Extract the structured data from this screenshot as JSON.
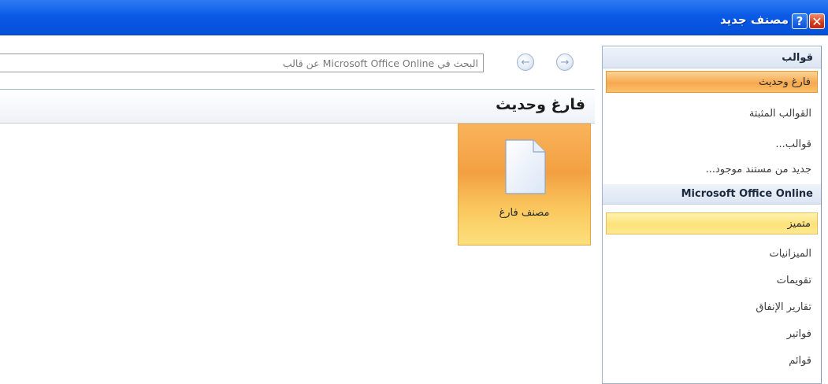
{
  "window": {
    "title": "مصنف جديد",
    "help_glyph": "?",
    "close_glyph": "✕"
  },
  "search": {
    "placeholder": "البحث في Microsoft Office Online عن قالب",
    "back_glyph": "←",
    "forward_glyph": "→"
  },
  "main": {
    "title": "فارغ وحديث",
    "tiles": [
      {
        "label": "مصنف فارغ",
        "icon": "blank-document-icon"
      }
    ]
  },
  "sidebar": {
    "sections": [
      {
        "header": "قوالب",
        "items": [
          {
            "label": "فارغ وحديث",
            "selected": true
          },
          {
            "label": "القوالب المثبتة"
          },
          {
            "label": "قوالب..."
          },
          {
            "label": "جديد من مستند موجود..."
          }
        ]
      },
      {
        "header": "Microsoft Office Online",
        "items": [
          {
            "label": "متميز",
            "hovered": true
          },
          {
            "label": "الميزانيات"
          },
          {
            "label": "تقويمات"
          },
          {
            "label": "تقارير الإنفاق"
          },
          {
            "label": "فواتير"
          },
          {
            "label": "قوائم"
          }
        ]
      }
    ]
  },
  "colors": {
    "titlebar": "#0a5ae6",
    "selected_orange": "#f7a84e",
    "hover_yellow": "#fde27a"
  }
}
